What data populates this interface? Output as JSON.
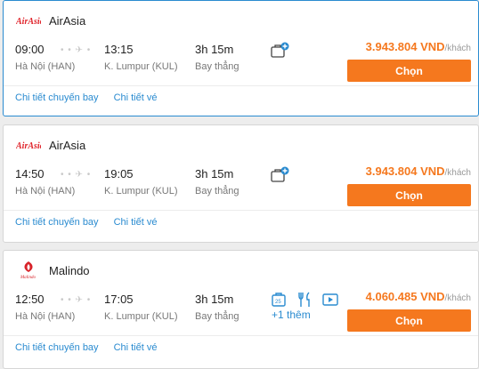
{
  "colors": {
    "accent": "#f5781e",
    "link": "#2a8bd0",
    "selected_border": "#2a8bd0"
  },
  "flights": [
    {
      "airline": "AirAsia",
      "logo_icon": "airasia-logo",
      "logo_text": "AirAsia",
      "depart_time": "09:00",
      "depart_airport": "Hà Nội (HAN)",
      "arrive_time": "13:15",
      "arrive_airport": "K. Lumpur (KUL)",
      "duration": "3h 15m",
      "stops": "Bay thẳng",
      "facilities": [
        "baggage-add-icon"
      ],
      "more": "",
      "price": "3.943.804 VND",
      "price_unit": "/khách",
      "choose_label": "Chọn",
      "details_link": "Chi tiết chuyến bay",
      "ticket_link": "Chi tiết vé"
    },
    {
      "airline": "AirAsia",
      "logo_icon": "airasia-logo",
      "logo_text": "AirAsia",
      "depart_time": "14:50",
      "depart_airport": "Hà Nội (HAN)",
      "arrive_time": "19:05",
      "arrive_airport": "K. Lumpur (KUL)",
      "duration": "3h 15m",
      "stops": "Bay thẳng",
      "facilities": [
        "baggage-add-icon"
      ],
      "more": "",
      "price": "3.943.804 VND",
      "price_unit": "/khách",
      "choose_label": "Chọn",
      "details_link": "Chi tiết chuyến bay",
      "ticket_link": "Chi tiết vé"
    },
    {
      "airline": "Malindo",
      "logo_icon": "malindo-logo",
      "logo_text": "Malindo",
      "depart_time": "12:50",
      "depart_airport": "Hà Nội (HAN)",
      "arrive_time": "17:05",
      "arrive_airport": "K. Lumpur (KUL)",
      "duration": "3h 15m",
      "stops": "Bay thẳng",
      "facilities": [
        "baggage-icon",
        "meal-icon",
        "entertainment-icon"
      ],
      "more": "+1 thêm",
      "price": "4.060.485 VND",
      "price_unit": "/khách",
      "choose_label": "Chọn",
      "details_link": "Chi tiết chuyến bay",
      "ticket_link": "Chi tiết vé"
    }
  ]
}
